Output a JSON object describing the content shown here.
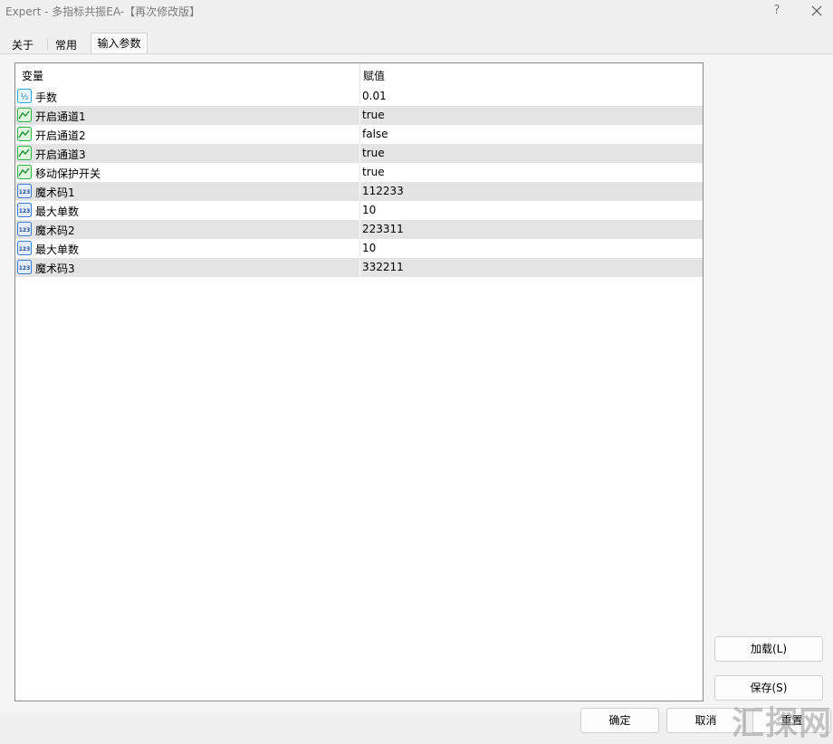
{
  "window": {
    "title": "Expert - 多指标共振EA-【再次修改版】",
    "help": "?"
  },
  "tabs": [
    {
      "label": "关于",
      "active": false
    },
    {
      "label": "常用",
      "active": false
    },
    {
      "label": "输入参数",
      "active": true
    }
  ],
  "table": {
    "headers": {
      "variable": "变量",
      "value": "赋值"
    },
    "rows": [
      {
        "icon": "fraction-icon",
        "name": "手数",
        "value": "0.01"
      },
      {
        "icon": "boolean-chart-icon",
        "name": "开启通道1",
        "value": "true"
      },
      {
        "icon": "boolean-chart-icon",
        "name": "开启通道2",
        "value": "false"
      },
      {
        "icon": "boolean-chart-icon",
        "name": "开启通道3",
        "value": "true"
      },
      {
        "icon": "boolean-chart-icon",
        "name": "移动保护开关",
        "value": "true"
      },
      {
        "icon": "integer-icon",
        "name": "魔术码1",
        "value": "112233"
      },
      {
        "icon": "integer-icon",
        "name": "最大单数",
        "value": "10"
      },
      {
        "icon": "integer-icon",
        "name": "魔术码2",
        "value": "223311"
      },
      {
        "icon": "integer-icon",
        "name": "最大单数",
        "value": "10"
      },
      {
        "icon": "integer-icon",
        "name": "魔术码3",
        "value": "332211"
      }
    ]
  },
  "buttons": {
    "load": "加载(L)",
    "save": "保存(S)",
    "ok": "确定",
    "cancel": "取消",
    "reset": "重置"
  },
  "watermark": "汇探网",
  "colors": {
    "row_alt": "#e4e4e4",
    "bool_icon_green": "#2fb34a",
    "int_icon_blue": "#3a7bd5",
    "fraction_icon_cyan": "#2aa7d8"
  }
}
